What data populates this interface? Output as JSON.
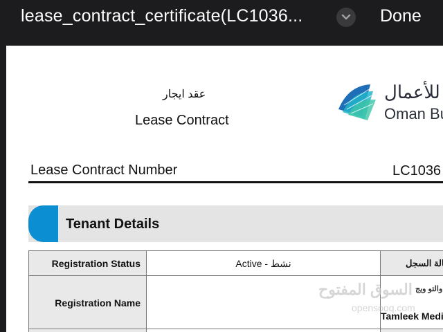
{
  "topbar": {
    "file_title": "lease_contract_certificate(LC1036...",
    "done_label": "Done",
    "chevron_icon": "chevron-down-icon"
  },
  "document": {
    "title_ar": "عقد ايجار",
    "title_en": "Lease Contract",
    "logo": {
      "text_ar": "للأعمال",
      "text_en": "Oman Bu",
      "colors": [
        "#1e6fb8",
        "#22b5c9",
        "#3dc6a8"
      ]
    },
    "contract_number": {
      "label": "Lease Contract Number",
      "value": "LC1036"
    },
    "section": {
      "title": "Tenant Details",
      "accent_color": "#0b8fd2"
    },
    "table": {
      "rows": [
        {
          "label_en": "Registration Status",
          "value": "Active - نشط",
          "label_ar": "حالة السجل"
        },
        {
          "label_en": "Registration Name",
          "value_ar_partial": "والتو ويج",
          "value_en_partial": "Tamleek Medi"
        }
      ]
    },
    "watermark": {
      "text_ar": "السوق المفتوح",
      "text_en": "opensooq.com"
    }
  }
}
